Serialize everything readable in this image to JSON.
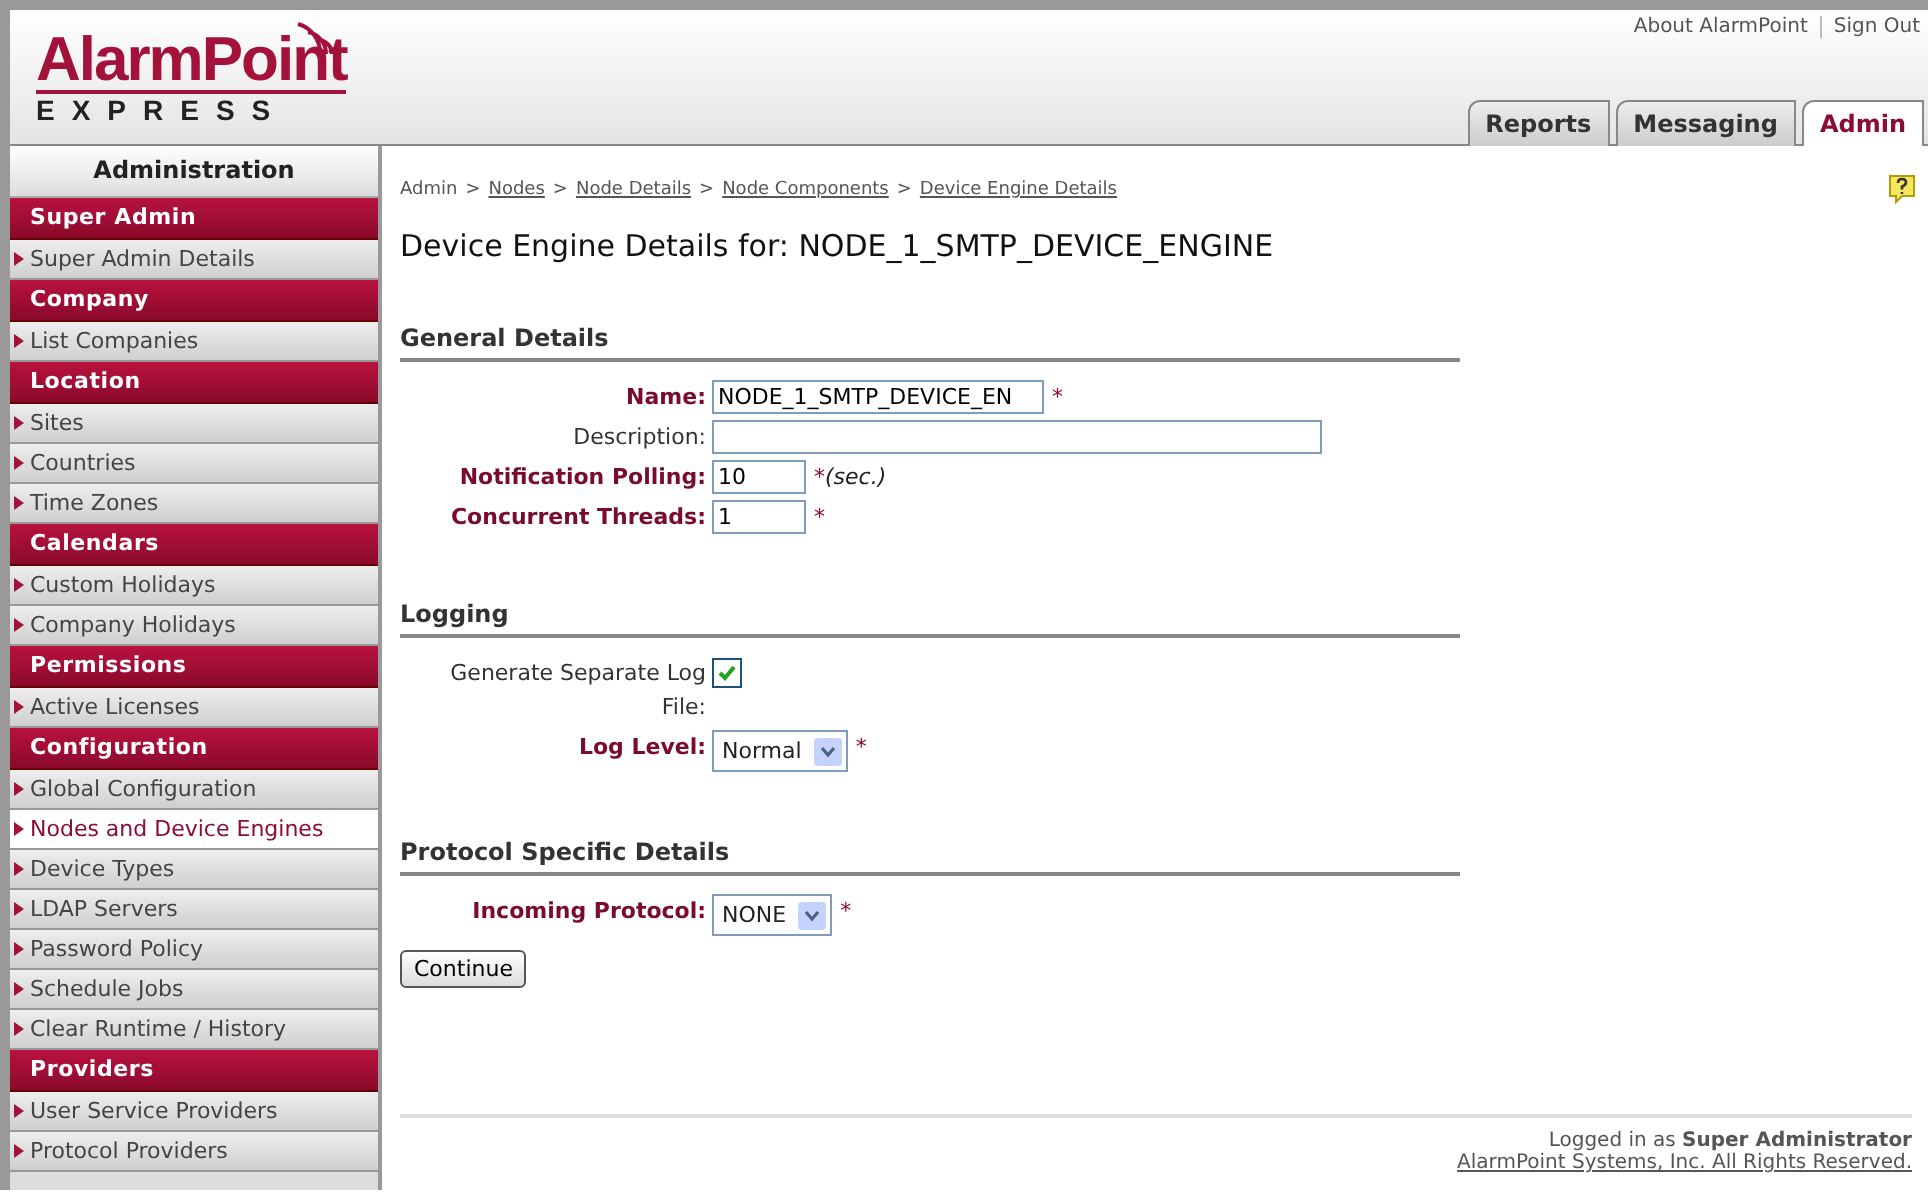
{
  "logo": {
    "name": "AlarmPoint",
    "sub": "EXPRESS"
  },
  "top_links": [
    "About AlarmPoint",
    "Sign Out"
  ],
  "tabs": [
    {
      "label": "Reports",
      "selected": false
    },
    {
      "label": "Messaging",
      "selected": false
    },
    {
      "label": "Admin",
      "selected": true
    }
  ],
  "sidebar": {
    "title": "Administration",
    "sections": [
      {
        "title": "Super Admin",
        "items": [
          {
            "label": "Super Admin Details",
            "selected": false
          }
        ]
      },
      {
        "title": "Company",
        "items": [
          {
            "label": "List Companies",
            "selected": false
          }
        ]
      },
      {
        "title": "Location",
        "items": [
          {
            "label": "Sites",
            "selected": false
          },
          {
            "label": "Countries",
            "selected": false
          },
          {
            "label": "Time Zones",
            "selected": false
          }
        ]
      },
      {
        "title": "Calendars",
        "items": [
          {
            "label": "Custom Holidays",
            "selected": false
          },
          {
            "label": "Company Holidays",
            "selected": false
          }
        ]
      },
      {
        "title": "Permissions",
        "items": [
          {
            "label": "Active Licenses",
            "selected": false
          }
        ]
      },
      {
        "title": "Configuration",
        "items": [
          {
            "label": "Global Configuration",
            "selected": false
          },
          {
            "label": "Nodes and Device Engines",
            "selected": true
          },
          {
            "label": "Device Types",
            "selected": false
          },
          {
            "label": "LDAP Servers",
            "selected": false
          },
          {
            "label": "Password Policy",
            "selected": false
          },
          {
            "label": "Schedule Jobs",
            "selected": false
          },
          {
            "label": "Clear Runtime / History",
            "selected": false
          }
        ]
      },
      {
        "title": "Providers",
        "items": [
          {
            "label": "User Service Providers",
            "selected": false
          },
          {
            "label": "Protocol Providers",
            "selected": false
          }
        ]
      }
    ]
  },
  "breadcrumb_separator": ">",
  "required_mark": "*",
  "breadcrumb": [
    {
      "label": "Admin",
      "link": false
    },
    {
      "label": "Nodes",
      "link": true
    },
    {
      "label": "Node Details",
      "link": true
    },
    {
      "label": "Node Components",
      "link": true
    },
    {
      "label": "Device Engine Details",
      "link": true
    }
  ],
  "page_title": "Device Engine Details for: NODE_1_SMTP_DEVICE_ENGINE",
  "sections": [
    {
      "title": "General Details",
      "fields": [
        {
          "kind": "text",
          "label": "Name:",
          "required": true,
          "value": "NODE_1_SMTP_DEVICE_EN"
        },
        {
          "kind": "text",
          "label": "Description:",
          "required": false
        },
        {
          "kind": "number",
          "label": "Notification Polling:",
          "required": true,
          "value": "10",
          "unit": "(sec.)"
        },
        {
          "kind": "number",
          "label": "Concurrent Threads:",
          "required": true,
          "value": "1"
        }
      ]
    },
    {
      "title": "Logging",
      "fields": [
        {
          "kind": "checkbox",
          "label": "Generate Separate Log File:",
          "required": false,
          "checked": true
        },
        {
          "kind": "select",
          "label": "Log Level:",
          "required": true,
          "value": "Normal"
        }
      ]
    },
    {
      "title": "Protocol Specific Details",
      "fields": [
        {
          "kind": "select",
          "label": "Incoming Protocol:",
          "required": true,
          "value": "NONE"
        }
      ]
    }
  ],
  "button": "Continue",
  "footer": {
    "login": "Logged in as **Super Administrator**",
    "copyright": "AlarmPoint Systems, Inc. All Rights Reserved."
  }
}
